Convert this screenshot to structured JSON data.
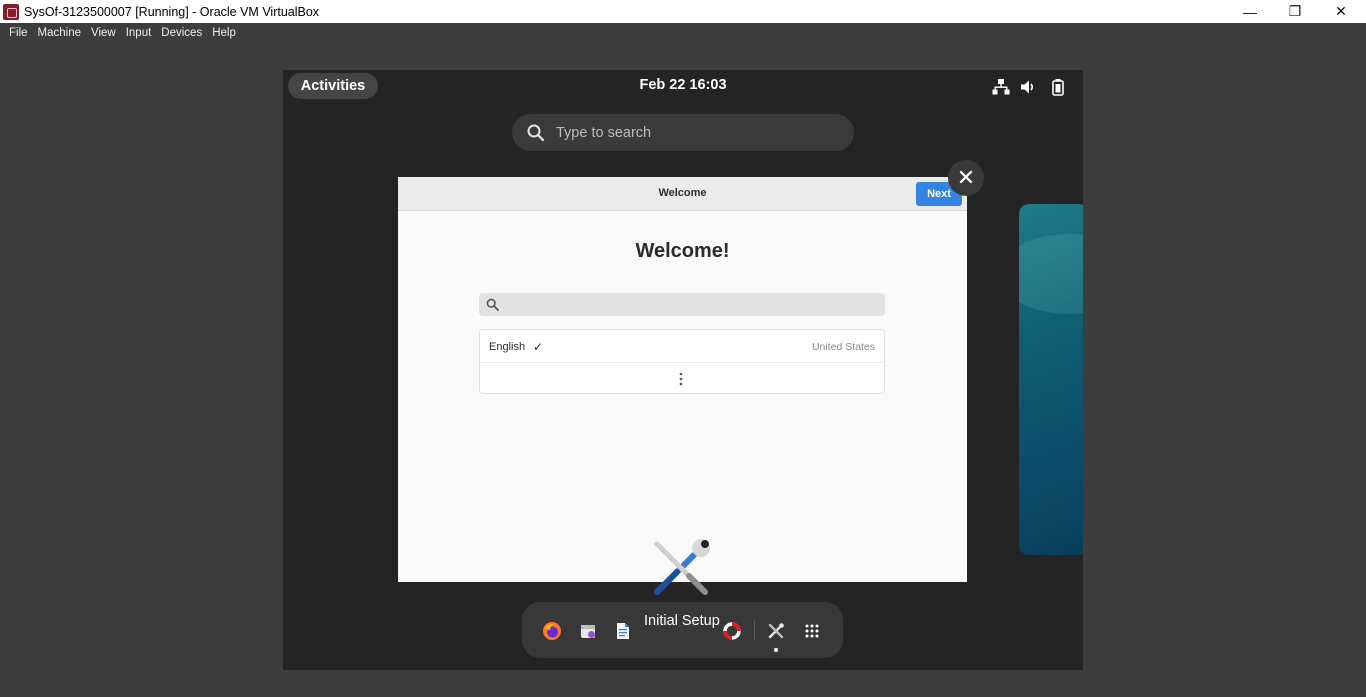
{
  "window": {
    "title": "SysOf-3123500007 [Running] - Oracle VM VirtualBox",
    "controls": {
      "minimize": "—",
      "restore": "❐",
      "close": "✕"
    }
  },
  "menubar": {
    "items": [
      "File",
      "Machine",
      "View",
      "Input",
      "Devices",
      "Help"
    ]
  },
  "gnome": {
    "activities": "Activities",
    "clock": "Feb 22  16:03",
    "search_placeholder": "Type to search",
    "tray_icons": [
      "network-icon",
      "volume-icon",
      "battery-icon"
    ]
  },
  "welcome_window": {
    "title": "Welcome",
    "next_label": "Next",
    "heading": "Welcome!",
    "language_rows": [
      {
        "language": "English",
        "check": "✓",
        "region": "United States"
      }
    ],
    "close_glyph": "✕"
  },
  "dash": {
    "app_icons": [
      "firefox-icon",
      "calendar-icon",
      "text-editor-icon",
      "help-icon",
      "tools-icon",
      "app-grid-icon"
    ],
    "tooltip": "Initial Setup"
  },
  "colors": {
    "desktop": "#242424",
    "accent": "#3584e4",
    "host_bg": "#3d3d3d"
  }
}
